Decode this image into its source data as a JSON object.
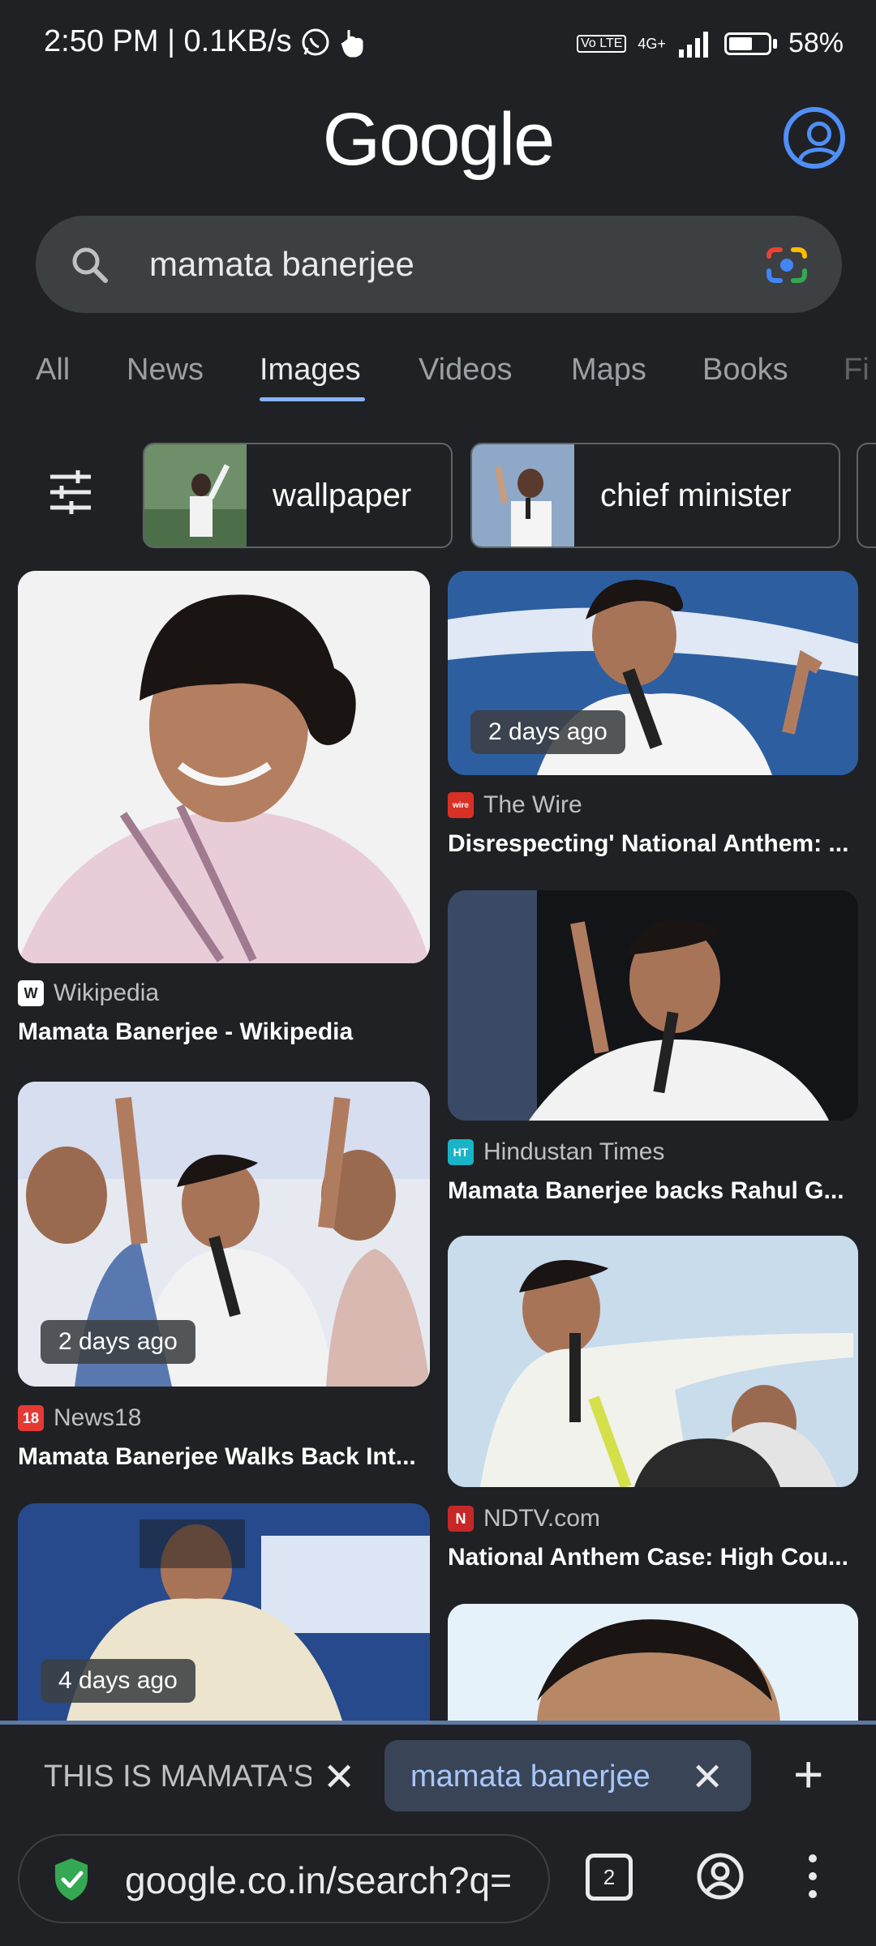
{
  "status_bar": {
    "time_speed": "2:50 PM | 0.1KB/s",
    "network": "4G+",
    "volte": "Vo LTE",
    "battery": "58%"
  },
  "header": {
    "logo": "Google"
  },
  "search": {
    "query": "mamata banerjee"
  },
  "tabs": [
    "All",
    "News",
    "Images",
    "Videos",
    "Maps",
    "Books",
    "Fi"
  ],
  "active_tab": "Images",
  "chips": [
    {
      "label": "wallpaper"
    },
    {
      "label": "chief minister"
    }
  ],
  "results": [
    {
      "source": "Wikipedia",
      "title": "Mamata Banerjee - Wikipedia",
      "favicon": "W",
      "time": ""
    },
    {
      "source": "The Wire",
      "title": "Disrespecting' National Anthem: ...",
      "favicon": "wire",
      "time": "2 days ago"
    },
    {
      "source": "Hindustan Times",
      "title": "Mamata Banerjee backs Rahul G...",
      "favicon": "HT",
      "time": ""
    },
    {
      "source": "News18",
      "title": "Mamata Banerjee Walks Back Int...",
      "favicon": "18",
      "time": "2 days ago"
    },
    {
      "source": "NDTV.com",
      "title": "National Anthem Case: High Cou...",
      "favicon": "N",
      "time": ""
    },
    {
      "source": "",
      "title": "",
      "favicon": "",
      "time": "4 days ago"
    }
  ],
  "browser": {
    "tab1": "THIS IS MAMATA'S",
    "tab2": "mamata banerjee",
    "url": "google.co.in/search?q=m",
    "tab_count": "2"
  },
  "colors": {
    "background": "#202124",
    "accent": "#8ab4f8",
    "search_bg": "#3c4043"
  }
}
